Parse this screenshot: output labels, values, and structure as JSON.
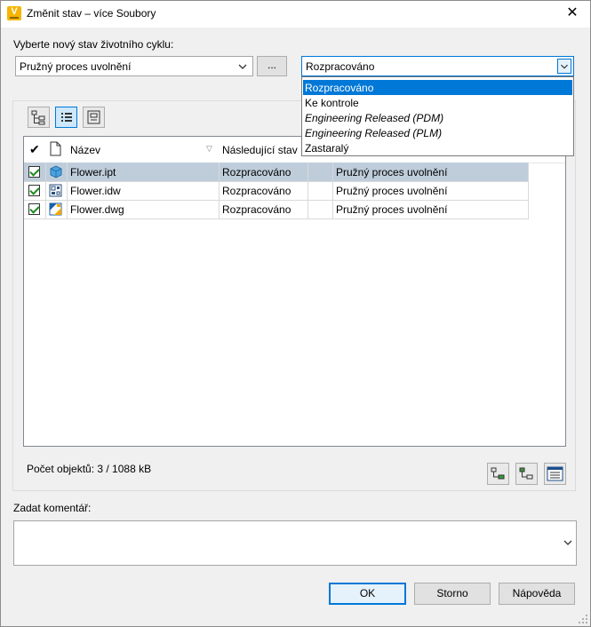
{
  "window": {
    "title": "Změnit stav – více Soubory",
    "app_icon_letter": "V"
  },
  "lifecycle": {
    "label": "Vyberte nový stav životního cyklu:",
    "process_value": "Pružný proces uvolnění",
    "browse_label": "...",
    "state_value": "Rozpracováno",
    "state_options": [
      {
        "label": "Rozpracováno",
        "selected": true,
        "italic": false
      },
      {
        "label": "Ke kontrole",
        "selected": false,
        "italic": false
      },
      {
        "label": "Engineering Released (PDM)",
        "selected": false,
        "italic": true
      },
      {
        "label": "Engineering Released (PLM)",
        "selected": false,
        "italic": true
      },
      {
        "label": "Zastaralý",
        "selected": false,
        "italic": false
      }
    ]
  },
  "grid": {
    "columns": {
      "check": "✔",
      "name": "Název",
      "next_state": "Následující stav"
    },
    "rows": [
      {
        "checked": true,
        "name": "Flower.ipt",
        "icon": "part-cube-icon",
        "next_state": "Rozpracováno",
        "process": "Pružný proces uvolnění",
        "highlighted": true
      },
      {
        "checked": true,
        "name": "Flower.idw",
        "icon": "drawing-idw-icon",
        "next_state": "Rozpracováno",
        "process": "Pružný proces uvolnění",
        "highlighted": false
      },
      {
        "checked": true,
        "name": "Flower.dwg",
        "icon": "drawing-dwg-icon",
        "next_state": "Rozpracováno",
        "process": "Pružný proces uvolnění",
        "highlighted": false
      }
    ]
  },
  "status": {
    "object_count": "Počet objektů: 3 / 1088 kB"
  },
  "comment": {
    "label": "Zadat komentář:",
    "value": ""
  },
  "buttons": {
    "ok": "OK",
    "cancel": "Storno",
    "help": "Nápověda"
  },
  "colors": {
    "accent": "#0078d7",
    "row_highlight": "#bfcddb",
    "app_icon": "#f6b400"
  }
}
